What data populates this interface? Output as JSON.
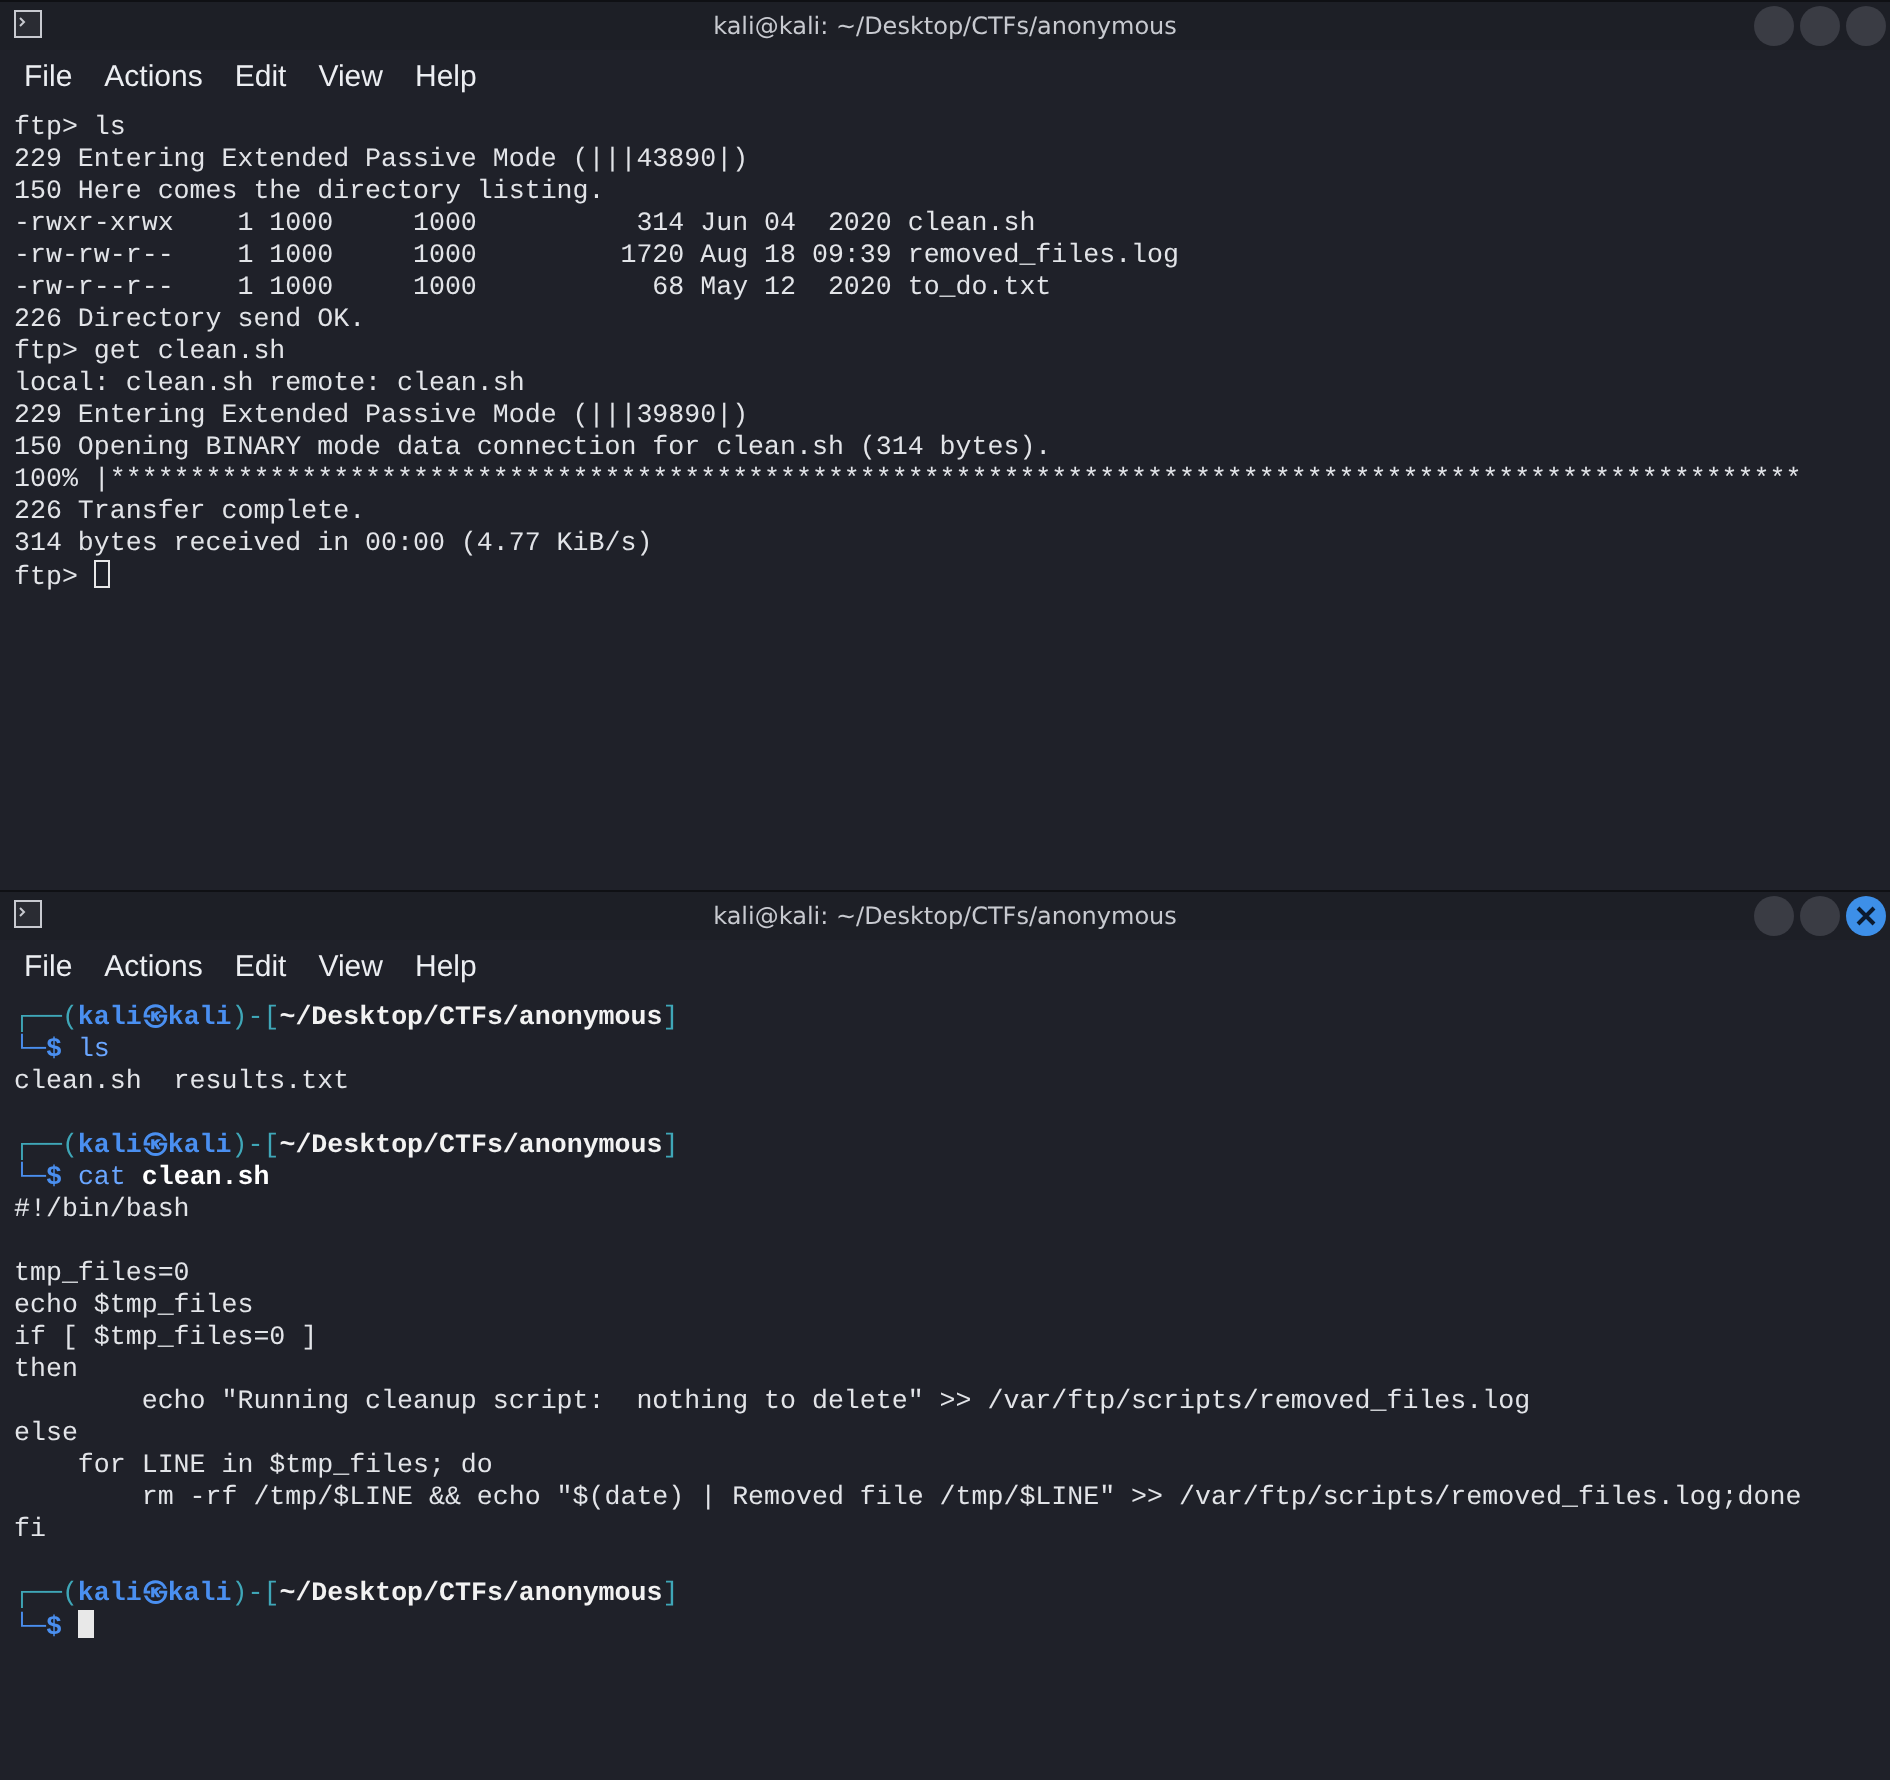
{
  "windows": [
    {
      "title": "kali@kali: ~/Desktop/CTFs/anonymous",
      "active": false,
      "menu": [
        "File",
        "Actions",
        "Edit",
        "View",
        "Help"
      ],
      "lines": [
        {
          "kind": "output",
          "text": "ftp> ls"
        },
        {
          "kind": "output",
          "text": "229 Entering Extended Passive Mode (|||43890|)"
        },
        {
          "kind": "output",
          "text": "150 Here comes the directory listing."
        },
        {
          "kind": "output",
          "text": "-rwxr-xrwx    1 1000     1000          314 Jun 04  2020 clean.sh"
        },
        {
          "kind": "output",
          "text": "-rw-rw-r--    1 1000     1000         1720 Aug 18 09:39 removed_files.log"
        },
        {
          "kind": "output",
          "text": "-rw-r--r--    1 1000     1000           68 May 12  2020 to_do.txt"
        },
        {
          "kind": "output",
          "text": "226 Directory send OK."
        },
        {
          "kind": "output",
          "text": "ftp> get clean.sh"
        },
        {
          "kind": "output",
          "text": "local: clean.sh remote: clean.sh"
        },
        {
          "kind": "output",
          "text": "229 Entering Extended Passive Mode (|||39890|)"
        },
        {
          "kind": "output",
          "text": "150 Opening BINARY mode data connection for clean.sh (314 bytes)."
        },
        {
          "kind": "output",
          "text": "100% |**********************************************************************************************************"
        },
        {
          "kind": "output",
          "text": "226 Transfer complete."
        },
        {
          "kind": "output",
          "text": "314 bytes received in 00:00 (4.77 KiB/s)"
        },
        {
          "kind": "output",
          "text": "ftp> ",
          "cursor": true
        }
      ]
    },
    {
      "title": "kali@kali: ~/Desktop/CTFs/anonymous",
      "active": true,
      "menu": [
        "File",
        "Actions",
        "Edit",
        "View",
        "Help"
      ],
      "lines": [
        {
          "kind": "prompt",
          "top_open": "┌──(",
          "identity": "kali㉿kali",
          "mid": ")-[",
          "path": "~/Desktop/CTFs/anonymous",
          "close": "]",
          "bottom": "└─$",
          "command": "ls"
        },
        {
          "kind": "output",
          "text": "clean.sh  results.txt"
        },
        {
          "kind": "blank"
        },
        {
          "kind": "prompt",
          "top_open": "┌──(",
          "identity": "kali㉿kali",
          "mid": ")-[",
          "path": "~/Desktop/CTFs/anonymous",
          "close": "]",
          "bottom": "└─$",
          "command": "cat",
          "args": "clean.sh"
        },
        {
          "kind": "output",
          "text": "#!/bin/bash"
        },
        {
          "kind": "blank"
        },
        {
          "kind": "output",
          "text": "tmp_files=0"
        },
        {
          "kind": "output",
          "text": "echo $tmp_files"
        },
        {
          "kind": "output",
          "text": "if [ $tmp_files=0 ]"
        },
        {
          "kind": "output",
          "text": "then"
        },
        {
          "kind": "output",
          "text": "        echo \"Running cleanup script:  nothing to delete\" >> /var/ftp/scripts/removed_files.log"
        },
        {
          "kind": "output",
          "text": "else"
        },
        {
          "kind": "output",
          "text": "    for LINE in $tmp_files; do"
        },
        {
          "kind": "output",
          "text": "        rm -rf /tmp/$LINE && echo \"$(date) | Removed file /tmp/$LINE\" >> /var/ftp/scripts/removed_files.log;done"
        },
        {
          "kind": "output",
          "text": "fi"
        },
        {
          "kind": "blank"
        },
        {
          "kind": "prompt",
          "top_open": "┌──(",
          "identity": "kali㉿kali",
          "mid": ")-[",
          "path": "~/Desktop/CTFs/anonymous",
          "close": "]",
          "bottom": "└─$",
          "cursor": true
        }
      ]
    }
  ]
}
